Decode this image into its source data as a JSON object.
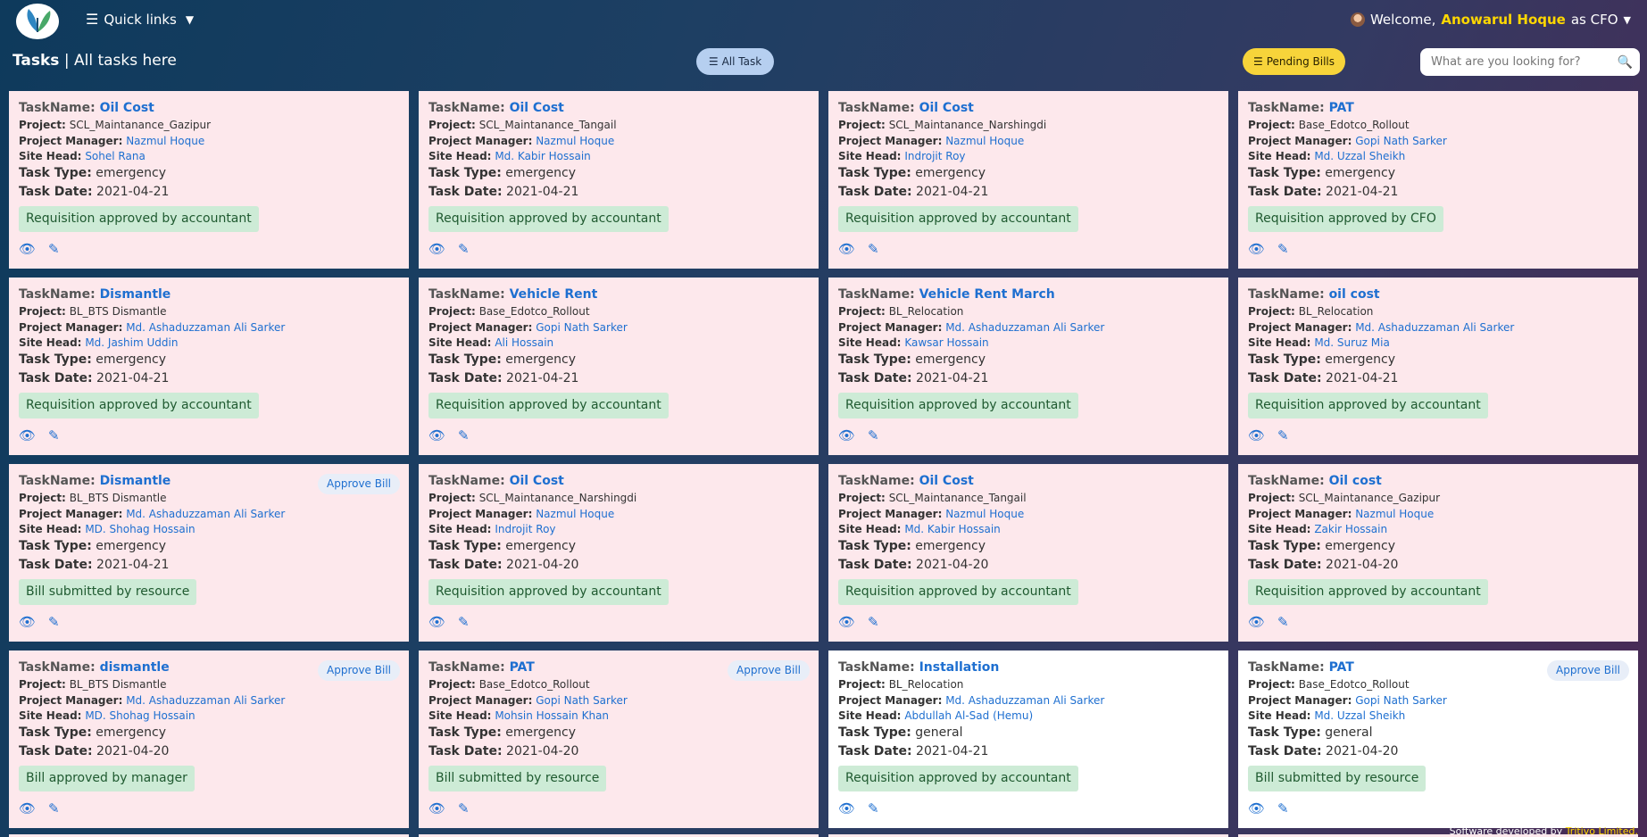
{
  "topbar": {
    "quick_links": "Quick links",
    "welcome_prefix": "Welcome,",
    "user_name": "Anowarul Hoque",
    "role": "as CFO"
  },
  "page": {
    "title_bold": "Tasks",
    "title_sep": " | ",
    "title_rest": "All tasks here",
    "all_task_btn": "All Task",
    "pending_bills_btn": "Pending Bills",
    "search_placeholder": "What are you looking for?"
  },
  "labels": {
    "task_name": "TaskName:",
    "project": "Project:",
    "project_manager": "Project Manager:",
    "site_head": "Site Head:",
    "task_type": "Task Type:",
    "task_date": "Task Date:",
    "approve_bill": "Approve Bill"
  },
  "tasks": [
    {
      "name": "Oil Cost",
      "project": "SCL_Maintanance_Gazipur",
      "pm": "Nazmul Hoque",
      "site_head": "Sohel Rana",
      "type": "emergency",
      "date": "2021-04-21",
      "status": "Requisition approved by accountant"
    },
    {
      "name": "Oil Cost",
      "project": "SCL_Maintanance_Tangail",
      "pm": "Nazmul Hoque",
      "site_head": "Md. Kabir Hossain",
      "type": "emergency",
      "date": "2021-04-21",
      "status": "Requisition approved by accountant"
    },
    {
      "name": "Oil Cost",
      "project": "SCL_Maintanance_Narshingdi",
      "pm": "Nazmul Hoque",
      "site_head": "Indrojit Roy",
      "type": "emergency",
      "date": "2021-04-21",
      "status": "Requisition approved by accountant"
    },
    {
      "name": "PAT",
      "project": "Base_Edotco_Rollout",
      "pm": "Gopi Nath Sarker",
      "site_head": "Md. Uzzal Sheikh",
      "type": "emergency",
      "date": "2021-04-21",
      "status": "Requisition approved by CFO"
    },
    {
      "name": "Dismantle",
      "project": "BL_BTS Dismantle",
      "pm": "Md. Ashaduzzaman Ali Sarker",
      "site_head": "Md. Jashim Uddin",
      "type": "emergency",
      "date": "2021-04-21",
      "status": "Requisition approved by accountant"
    },
    {
      "name": "Vehicle Rent",
      "project": "Base_Edotco_Rollout",
      "pm": "Gopi Nath Sarker",
      "site_head": "Ali Hossain",
      "type": "emergency",
      "date": "2021-04-21",
      "status": "Requisition approved by accountant"
    },
    {
      "name": "Vehicle Rent March",
      "project": "BL_Relocation",
      "pm": "Md. Ashaduzzaman Ali Sarker",
      "site_head": "Kawsar Hossain",
      "type": "emergency",
      "date": "2021-04-21",
      "status": "Requisition approved by accountant"
    },
    {
      "name": "oil cost",
      "project": "BL_Relocation",
      "pm": "Md. Ashaduzzaman Ali Sarker",
      "site_head": "Md. Suruz Mia",
      "type": "emergency",
      "date": "2021-04-21",
      "status": "Requisition approved by accountant"
    },
    {
      "name": "Dismantle",
      "project": "BL_BTS Dismantle",
      "pm": "Md. Ashaduzzaman Ali Sarker",
      "site_head": "MD. Shohag Hossain",
      "type": "emergency",
      "date": "2021-04-21",
      "status": "Bill submitted by resource",
      "approve": true
    },
    {
      "name": "Oil Cost",
      "project": "SCL_Maintanance_Narshingdi",
      "pm": "Nazmul Hoque",
      "site_head": "Indrojit Roy",
      "type": "emergency",
      "date": "2021-04-20",
      "status": "Requisition approved by accountant"
    },
    {
      "name": "Oil Cost",
      "project": "SCL_Maintanance_Tangail",
      "pm": "Nazmul Hoque",
      "site_head": "Md. Kabir Hossain",
      "type": "emergency",
      "date": "2021-04-20",
      "status": "Requisition approved by accountant"
    },
    {
      "name": "Oil cost",
      "project": "SCL_Maintanance_Gazipur",
      "pm": "Nazmul Hoque",
      "site_head": "Zakir Hossain",
      "type": "emergency",
      "date": "2021-04-20",
      "status": "Requisition approved by accountant"
    },
    {
      "name": "dismantle",
      "project": "BL_BTS Dismantle",
      "pm": "Md. Ashaduzzaman Ali Sarker",
      "site_head": "MD. Shohag Hossain",
      "type": "emergency",
      "date": "2021-04-20",
      "status": "Bill approved by manager",
      "approve": true
    },
    {
      "name": "PAT",
      "project": "Base_Edotco_Rollout",
      "pm": "Gopi Nath Sarker",
      "site_head": "Mohsin Hossain Khan",
      "type": "emergency",
      "date": "2021-04-20",
      "status": "Bill submitted by resource",
      "approve": true
    },
    {
      "name": "Installation",
      "project": "BL_Relocation",
      "pm": "Md. Ashaduzzaman Ali Sarker",
      "site_head": "Abdullah Al-Sad (Hemu)",
      "type": "general",
      "date": "2021-04-21",
      "status": "Requisition approved by accountant",
      "white": true
    },
    {
      "name": "PAT",
      "project": "Base_Edotco_Rollout",
      "pm": "Gopi Nath Sarker",
      "site_head": "Md. Uzzal Sheikh",
      "type": "general",
      "date": "2021-04-20",
      "status": "Bill submitted by resource",
      "approve": true,
      "white": true
    }
  ],
  "footer": {
    "prefix": "Software developed by ",
    "company": "Tritivo Limited."
  },
  "colors": {
    "card_bg": "#fde8ec",
    "link": "#1e6fd0",
    "badge_bg": "#cdebd6",
    "pending_btn": "#f7d43a",
    "all_task_btn": "#b6cff0"
  }
}
